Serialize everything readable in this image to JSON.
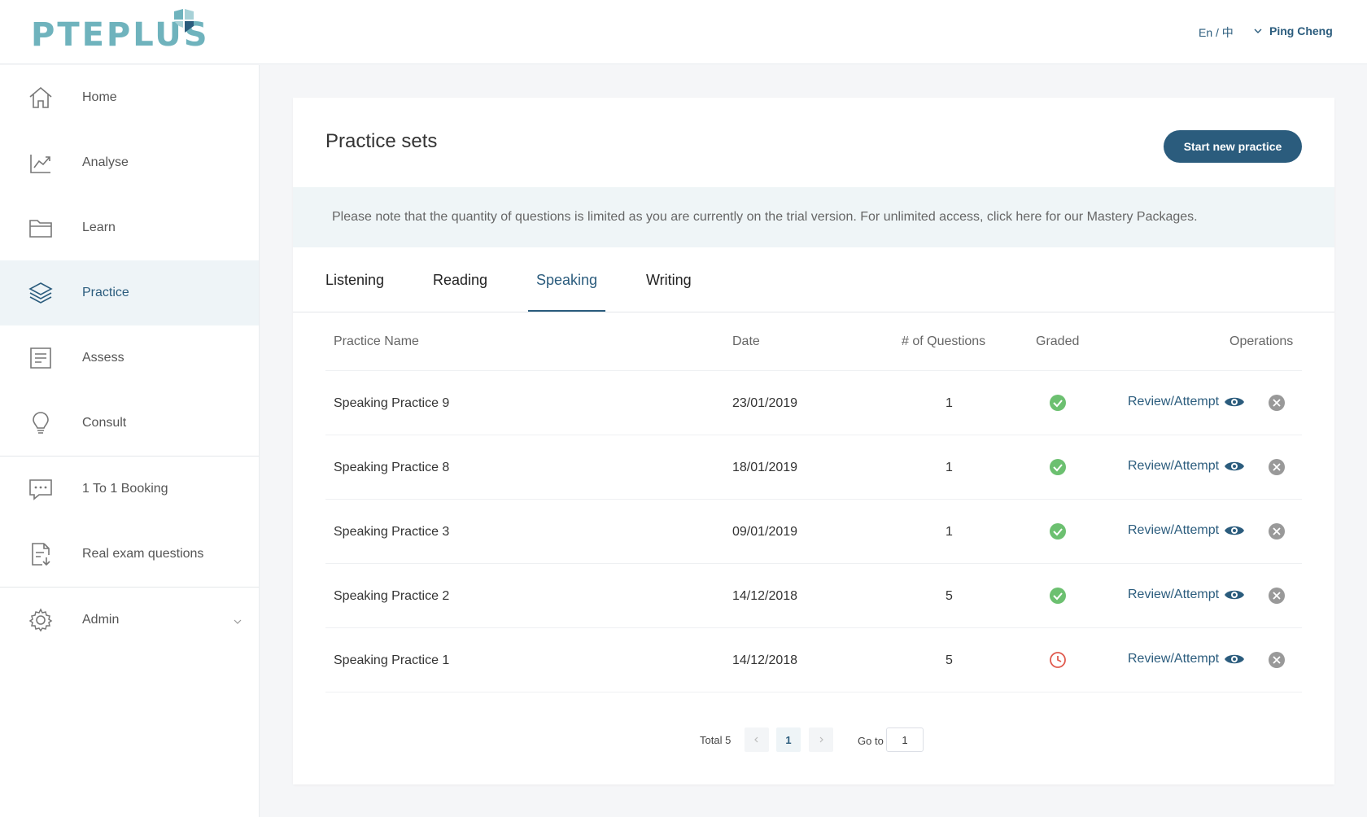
{
  "header": {
    "logo_text": "PTEPLUS",
    "language_toggle": "En / 中",
    "user_name": "Ping Cheng"
  },
  "colors": {
    "brand": "#2b5c7d",
    "logo": "#6fb3bd",
    "success": "#6cc070",
    "warning": "#e05a4e"
  },
  "sidebar": {
    "items": [
      {
        "label": "Home",
        "icon": "home-icon"
      },
      {
        "label": "Analyse",
        "icon": "chart-icon"
      },
      {
        "label": "Learn",
        "icon": "folder-icon"
      },
      {
        "label": "Practice",
        "icon": "layers-icon",
        "active": true
      },
      {
        "label": "Assess",
        "icon": "document-icon"
      },
      {
        "label": "Consult",
        "icon": "lightbulb-icon"
      },
      {
        "label": "1 To 1 Booking",
        "icon": "chat-icon"
      },
      {
        "label": "Real exam questions",
        "icon": "download-doc-icon"
      },
      {
        "label": "Admin",
        "icon": "gear-icon"
      }
    ]
  },
  "main": {
    "title": "Practice sets",
    "start_button": "Start new practice",
    "notice": "Please note that the quantity of questions is limited as you are currently on the trial version. For unlimited access, click here for our Mastery Packages.",
    "tabs": [
      {
        "label": "Listening"
      },
      {
        "label": "Reading"
      },
      {
        "label": "Speaking",
        "active": true
      },
      {
        "label": "Writing"
      }
    ],
    "table": {
      "columns": [
        "Practice Name",
        "Date",
        "# of Questions",
        "Graded",
        "Operations"
      ],
      "rows": [
        {
          "name": "Speaking Practice 9",
          "date": "23/01/2019",
          "questions": "1",
          "graded": "check-circle-icon",
          "action": "Review/Attempt"
        },
        {
          "name": "Speaking Practice 8",
          "date": "18/01/2019",
          "questions": "1",
          "graded": "check-circle-icon",
          "action": "Review/Attempt"
        },
        {
          "name": "Speaking Practice 3",
          "date": "09/01/2019",
          "questions": "1",
          "graded": "check-circle-icon",
          "action": "Review/Attempt"
        },
        {
          "name": "Speaking Practice 2",
          "date": "14/12/2018",
          "questions": "5",
          "graded": "check-circle-icon",
          "action": "Review/Attempt"
        },
        {
          "name": "Speaking Practice 1",
          "date": "14/12/2018",
          "questions": "5",
          "graded": "clock-icon",
          "action": "Review/Attempt"
        }
      ]
    },
    "pagination": {
      "total_label": "Total 5",
      "current_page": "1",
      "goto_label": "Go to",
      "goto_value": "1"
    }
  }
}
